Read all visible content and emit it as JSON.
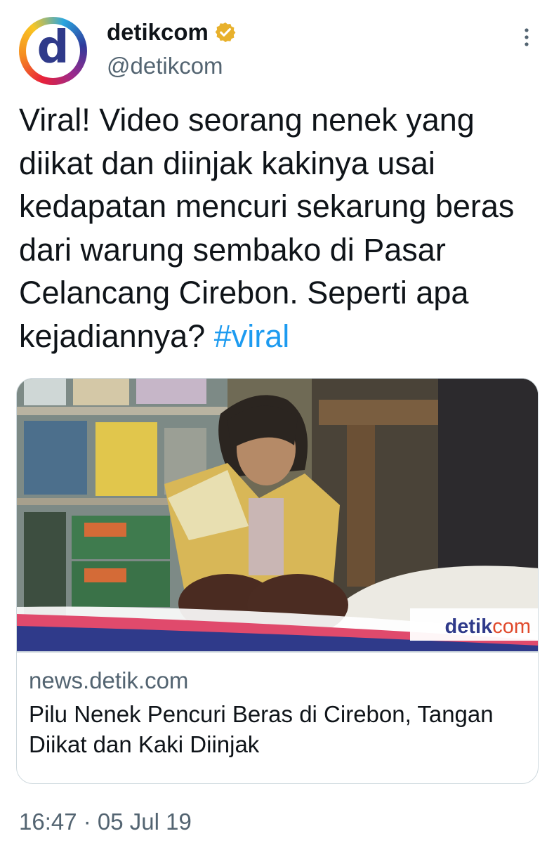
{
  "author": {
    "avatar_letter": "d",
    "display_name": "detikcom",
    "handle": "@detikcom",
    "verified_icon": "verified-badge-icon",
    "verified_color": "#e8b12c"
  },
  "menu": {
    "icon": "more-options-icon"
  },
  "tweet": {
    "text": "Viral! Video seorang nenek yang diikat dan diinjak kakinya usai kedapatan mencuri sekarung beras dari warung sembako di Pasar Celancang Cirebon. Seperti apa kejadiannya? ",
    "hashtag": "#viral",
    "hashtag_color": "#1d9bf0"
  },
  "card": {
    "image_watermark": "detikcom",
    "domain": "news.detik.com",
    "title": "Pilu Nenek Pencuri Beras di Cirebon, Tangan Diikat dan Kaki Diinjak"
  },
  "timestamp": "16:47 · 05 Jul 19"
}
